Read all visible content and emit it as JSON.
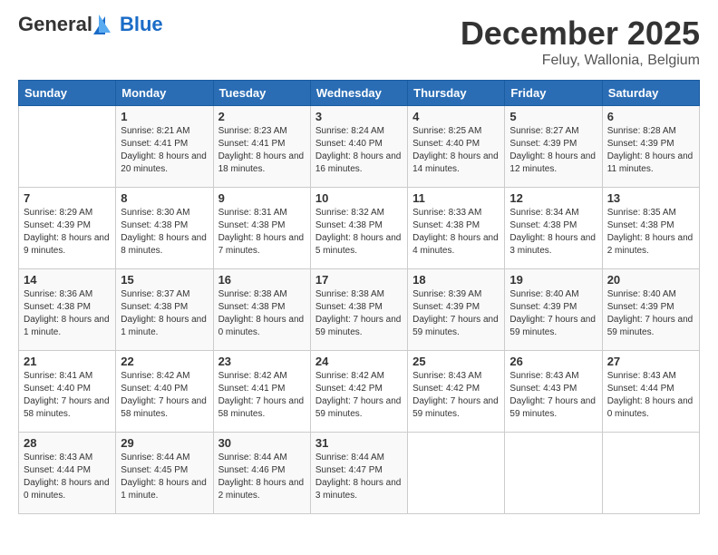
{
  "header": {
    "logo_general": "General",
    "logo_blue": "Blue",
    "title": "December 2025",
    "location": "Feluy, Wallonia, Belgium"
  },
  "days_of_week": [
    "Sunday",
    "Monday",
    "Tuesday",
    "Wednesday",
    "Thursday",
    "Friday",
    "Saturday"
  ],
  "weeks": [
    [
      {
        "day": "",
        "sunrise": "",
        "sunset": "",
        "daylight": ""
      },
      {
        "day": "1",
        "sunrise": "Sunrise: 8:21 AM",
        "sunset": "Sunset: 4:41 PM",
        "daylight": "Daylight: 8 hours and 20 minutes."
      },
      {
        "day": "2",
        "sunrise": "Sunrise: 8:23 AM",
        "sunset": "Sunset: 4:41 PM",
        "daylight": "Daylight: 8 hours and 18 minutes."
      },
      {
        "day": "3",
        "sunrise": "Sunrise: 8:24 AM",
        "sunset": "Sunset: 4:40 PM",
        "daylight": "Daylight: 8 hours and 16 minutes."
      },
      {
        "day": "4",
        "sunrise": "Sunrise: 8:25 AM",
        "sunset": "Sunset: 4:40 PM",
        "daylight": "Daylight: 8 hours and 14 minutes."
      },
      {
        "day": "5",
        "sunrise": "Sunrise: 8:27 AM",
        "sunset": "Sunset: 4:39 PM",
        "daylight": "Daylight: 8 hours and 12 minutes."
      },
      {
        "day": "6",
        "sunrise": "Sunrise: 8:28 AM",
        "sunset": "Sunset: 4:39 PM",
        "daylight": "Daylight: 8 hours and 11 minutes."
      }
    ],
    [
      {
        "day": "7",
        "sunrise": "Sunrise: 8:29 AM",
        "sunset": "Sunset: 4:39 PM",
        "daylight": "Daylight: 8 hours and 9 minutes."
      },
      {
        "day": "8",
        "sunrise": "Sunrise: 8:30 AM",
        "sunset": "Sunset: 4:38 PM",
        "daylight": "Daylight: 8 hours and 8 minutes."
      },
      {
        "day": "9",
        "sunrise": "Sunrise: 8:31 AM",
        "sunset": "Sunset: 4:38 PM",
        "daylight": "Daylight: 8 hours and 7 minutes."
      },
      {
        "day": "10",
        "sunrise": "Sunrise: 8:32 AM",
        "sunset": "Sunset: 4:38 PM",
        "daylight": "Daylight: 8 hours and 5 minutes."
      },
      {
        "day": "11",
        "sunrise": "Sunrise: 8:33 AM",
        "sunset": "Sunset: 4:38 PM",
        "daylight": "Daylight: 8 hours and 4 minutes."
      },
      {
        "day": "12",
        "sunrise": "Sunrise: 8:34 AM",
        "sunset": "Sunset: 4:38 PM",
        "daylight": "Daylight: 8 hours and 3 minutes."
      },
      {
        "day": "13",
        "sunrise": "Sunrise: 8:35 AM",
        "sunset": "Sunset: 4:38 PM",
        "daylight": "Daylight: 8 hours and 2 minutes."
      }
    ],
    [
      {
        "day": "14",
        "sunrise": "Sunrise: 8:36 AM",
        "sunset": "Sunset: 4:38 PM",
        "daylight": "Daylight: 8 hours and 1 minute."
      },
      {
        "day": "15",
        "sunrise": "Sunrise: 8:37 AM",
        "sunset": "Sunset: 4:38 PM",
        "daylight": "Daylight: 8 hours and 1 minute."
      },
      {
        "day": "16",
        "sunrise": "Sunrise: 8:38 AM",
        "sunset": "Sunset: 4:38 PM",
        "daylight": "Daylight: 8 hours and 0 minutes."
      },
      {
        "day": "17",
        "sunrise": "Sunrise: 8:38 AM",
        "sunset": "Sunset: 4:38 PM",
        "daylight": "Daylight: 7 hours and 59 minutes."
      },
      {
        "day": "18",
        "sunrise": "Sunrise: 8:39 AM",
        "sunset": "Sunset: 4:39 PM",
        "daylight": "Daylight: 7 hours and 59 minutes."
      },
      {
        "day": "19",
        "sunrise": "Sunrise: 8:40 AM",
        "sunset": "Sunset: 4:39 PM",
        "daylight": "Daylight: 7 hours and 59 minutes."
      },
      {
        "day": "20",
        "sunrise": "Sunrise: 8:40 AM",
        "sunset": "Sunset: 4:39 PM",
        "daylight": "Daylight: 7 hours and 59 minutes."
      }
    ],
    [
      {
        "day": "21",
        "sunrise": "Sunrise: 8:41 AM",
        "sunset": "Sunset: 4:40 PM",
        "daylight": "Daylight: 7 hours and 58 minutes."
      },
      {
        "day": "22",
        "sunrise": "Sunrise: 8:42 AM",
        "sunset": "Sunset: 4:40 PM",
        "daylight": "Daylight: 7 hours and 58 minutes."
      },
      {
        "day": "23",
        "sunrise": "Sunrise: 8:42 AM",
        "sunset": "Sunset: 4:41 PM",
        "daylight": "Daylight: 7 hours and 58 minutes."
      },
      {
        "day": "24",
        "sunrise": "Sunrise: 8:42 AM",
        "sunset": "Sunset: 4:42 PM",
        "daylight": "Daylight: 7 hours and 59 minutes."
      },
      {
        "day": "25",
        "sunrise": "Sunrise: 8:43 AM",
        "sunset": "Sunset: 4:42 PM",
        "daylight": "Daylight: 7 hours and 59 minutes."
      },
      {
        "day": "26",
        "sunrise": "Sunrise: 8:43 AM",
        "sunset": "Sunset: 4:43 PM",
        "daylight": "Daylight: 7 hours and 59 minutes."
      },
      {
        "day": "27",
        "sunrise": "Sunrise: 8:43 AM",
        "sunset": "Sunset: 4:44 PM",
        "daylight": "Daylight: 8 hours and 0 minutes."
      }
    ],
    [
      {
        "day": "28",
        "sunrise": "Sunrise: 8:43 AM",
        "sunset": "Sunset: 4:44 PM",
        "daylight": "Daylight: 8 hours and 0 minutes."
      },
      {
        "day": "29",
        "sunrise": "Sunrise: 8:44 AM",
        "sunset": "Sunset: 4:45 PM",
        "daylight": "Daylight: 8 hours and 1 minute."
      },
      {
        "day": "30",
        "sunrise": "Sunrise: 8:44 AM",
        "sunset": "Sunset: 4:46 PM",
        "daylight": "Daylight: 8 hours and 2 minutes."
      },
      {
        "day": "31",
        "sunrise": "Sunrise: 8:44 AM",
        "sunset": "Sunset: 4:47 PM",
        "daylight": "Daylight: 8 hours and 3 minutes."
      },
      {
        "day": "",
        "sunrise": "",
        "sunset": "",
        "daylight": ""
      },
      {
        "day": "",
        "sunrise": "",
        "sunset": "",
        "daylight": ""
      },
      {
        "day": "",
        "sunrise": "",
        "sunset": "",
        "daylight": ""
      }
    ]
  ]
}
